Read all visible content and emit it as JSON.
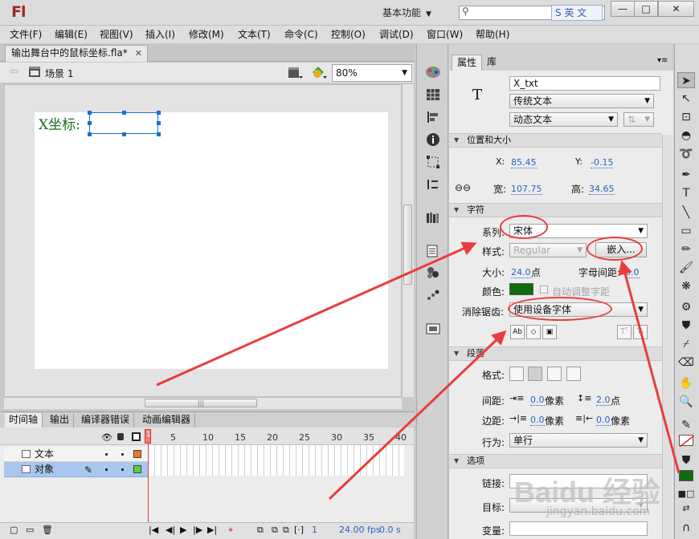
{
  "app": {
    "logo": "Fl",
    "workspace": "基本功能",
    "ime_label": "英 文"
  },
  "menu": [
    "文件(F)",
    "编辑(E)",
    "视图(V)",
    "插入(I)",
    "修改(M)",
    "文本(T)",
    "命令(C)",
    "控制(O)",
    "调试(D)",
    "窗口(W)",
    "帮助(H)"
  ],
  "document": {
    "tab_title": "输出舞台中的鼠标坐标.fla*",
    "scene": "场景 1",
    "zoom": "80%",
    "stage_label": "X坐标:"
  },
  "timeline": {
    "tabs": [
      "时间轴",
      "输出",
      "编译器错误",
      "动画编辑器"
    ],
    "frame_numbers": [
      "5",
      "10",
      "15",
      "20",
      "25",
      "30",
      "35",
      "40"
    ],
    "current_frame": "1",
    "layers": [
      {
        "name": "文本",
        "color": "#f07a1a"
      },
      {
        "name": "对象",
        "color": "#52d63f"
      }
    ],
    "footer": {
      "frame": "1",
      "fps": "24.00 fps",
      "time": "0.0 s"
    }
  },
  "properties": {
    "tabs": [
      "属性",
      "库"
    ],
    "instance_name": "X_txt",
    "text_engine": "传统文本",
    "text_type": "动态文本",
    "position_size": {
      "title": "位置和大小",
      "x_label": "X:",
      "x": "85.45",
      "y_label": "Y:",
      "y": "-0.15",
      "w_label": "宽:",
      "w": "107.75",
      "h_label": "高:",
      "h": "34.65"
    },
    "character": {
      "title": "字符",
      "family_label": "系列:",
      "family": "宋体",
      "style_label": "样式:",
      "style": "Regular",
      "embed_button": "嵌入...",
      "size_label": "大小:",
      "size": "24.0",
      "size_unit": "点",
      "letter_spacing_label": "字母间距:",
      "letter_spacing": "0.0",
      "color_label": "颜色:",
      "color": "#0f6b10",
      "auto_kern": "自动调整字距",
      "anti_alias_label": "消除锯齿:",
      "anti_alias": "使用设备字体"
    },
    "paragraph": {
      "title": "段落",
      "format_label": "格式:",
      "spacing_label": "间距:",
      "indent": "0.0",
      "indent_unit": "像素",
      "line_spacing": "2.0",
      "line_unit": "点",
      "margin_label": "边距:",
      "margin_left": "0.0",
      "margin_left_unit": "像素",
      "margin_right": "0.0",
      "margin_right_unit": "像素",
      "behavior_label": "行为:",
      "behavior": "单行"
    },
    "options": {
      "title": "选项",
      "link_label": "链接:",
      "target_label": "目标:",
      "variable_label": "变量:"
    }
  },
  "watermark": {
    "brand": "Baidu 经验",
    "url": "jingyan.baidu.com"
  }
}
